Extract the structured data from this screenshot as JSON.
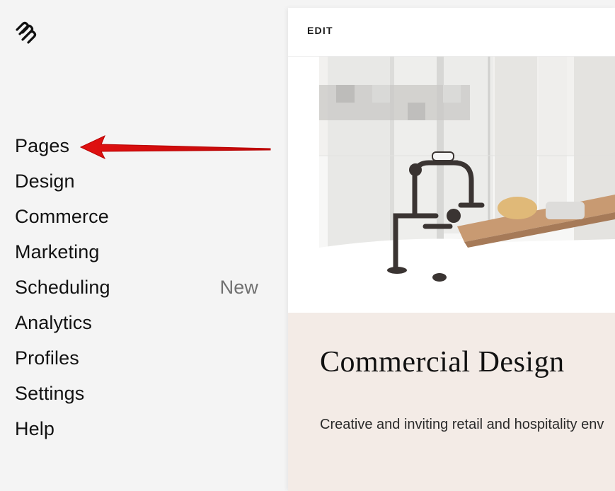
{
  "sidebar": {
    "logo_icon": "squarespace-logo-icon",
    "items": [
      {
        "label": "Pages",
        "badge": ""
      },
      {
        "label": "Design",
        "badge": ""
      },
      {
        "label": "Commerce",
        "badge": ""
      },
      {
        "label": "Marketing",
        "badge": ""
      },
      {
        "label": "Scheduling",
        "badge": "New"
      },
      {
        "label": "Analytics",
        "badge": ""
      },
      {
        "label": "Profiles",
        "badge": ""
      },
      {
        "label": "Settings",
        "badge": ""
      },
      {
        "label": "Help",
        "badge": ""
      }
    ]
  },
  "annotation": {
    "arrow_color": "#e01010",
    "arrow_icon": "red-arrow-pointing-left"
  },
  "preview": {
    "edit_label": "EDIT",
    "hero_image": "bathroom-faucet-photo",
    "heading": "Commercial Design",
    "description": "Creative and inviting retail and hospitality env",
    "section_bg": "#f3ebe6"
  }
}
